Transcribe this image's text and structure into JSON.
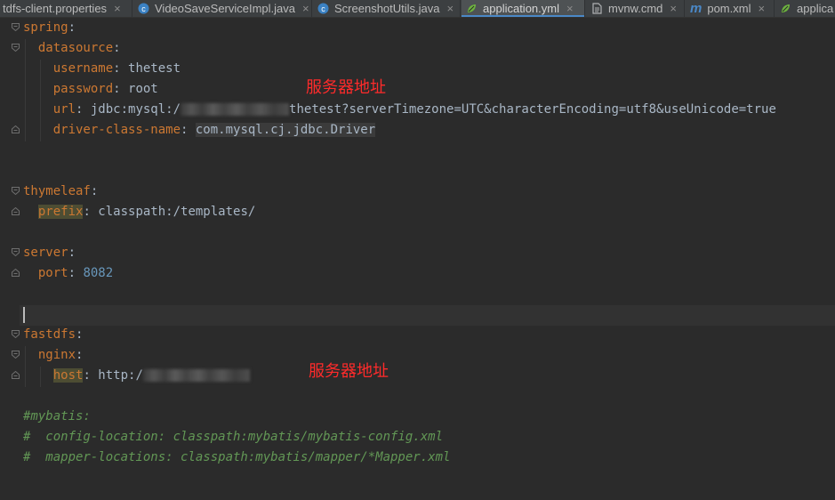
{
  "tabs": [
    {
      "label": "tdfs-client.properties",
      "icon": "properties-file-icon",
      "closable": true,
      "active": false
    },
    {
      "label": "VideoSaveServiceImpl.java",
      "icon": "java-class-icon",
      "closable": true,
      "active": false
    },
    {
      "label": "ScreenshotUtils.java",
      "icon": "java-class-icon",
      "closable": true,
      "active": false
    },
    {
      "label": "application.yml",
      "icon": "spring-leaf-icon",
      "closable": true,
      "active": true
    },
    {
      "label": "mvnw.cmd",
      "icon": "text-file-icon",
      "closable": true,
      "active": false
    },
    {
      "label": "pom.xml",
      "icon": "maven-icon",
      "closable": true,
      "active": false
    },
    {
      "label": "applica",
      "icon": "spring-leaf-icon",
      "closable": false,
      "active": false
    }
  ],
  "close_glyph": "×",
  "maven_glyph": "m",
  "code": {
    "spring": "spring",
    "datasource": "datasource",
    "username_key": "username",
    "username_val": "thetest",
    "password_key": "password",
    "password_val": "root",
    "url_key": "url",
    "url_prefix": "jdbc:mysql:/",
    "url_suffix": "thetest?serverTimezone=UTC&characterEncoding=utf8&useUnicode=true",
    "driver_key": "driver-class-name",
    "driver_val": "com.mysql.cj.jdbc.Driver",
    "thymeleaf": "thymeleaf",
    "prefix_key": "prefix",
    "prefix_val": "classpath:/templates/",
    "server": "server",
    "port_key": "port",
    "port_val": "8082",
    "fastdfs": "fastdfs",
    "nginx": "nginx",
    "host_key": "host",
    "host_val": "http:/",
    "comment1": "#mybatis:",
    "comment2": "#  config-location: classpath:mybatis/mybatis-config.xml",
    "comment3": "#  mapper-locations: classpath:mybatis/mapper/*Mapper.xml"
  },
  "annotations": {
    "server_address_1": "服务器地址",
    "server_address_2": "服务器地址"
  },
  "colors": {
    "background": "#2b2b2b",
    "key": "#cc7832",
    "value": "#a9b7c6",
    "number": "#6897bb",
    "comment": "#629755",
    "annotation": "#ff2b2b",
    "tab_underline": "#4a88c7"
  }
}
